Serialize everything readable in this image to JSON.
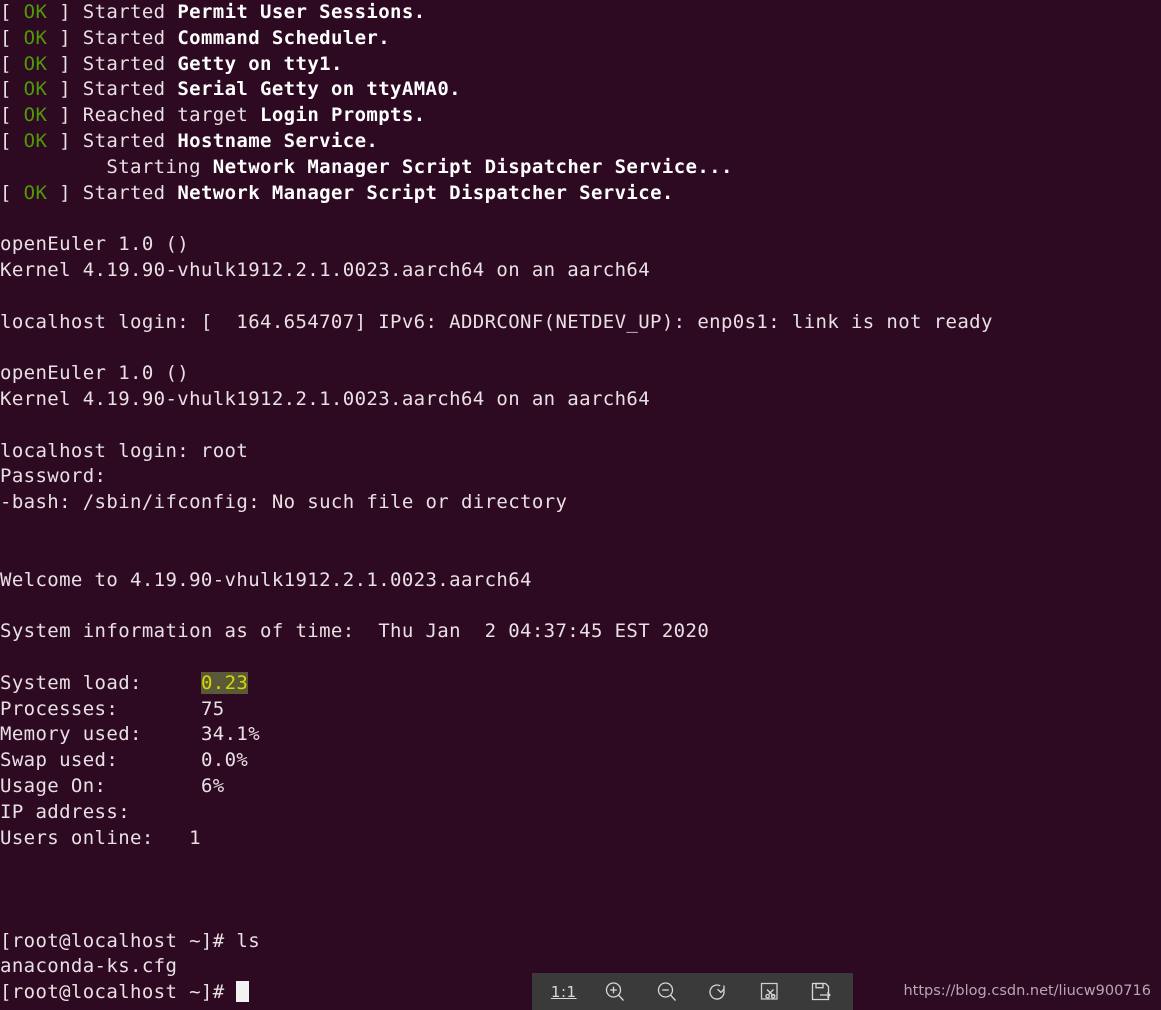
{
  "terminal": {
    "background_color": "#2d0a22",
    "text_color": "#e8e0e4",
    "ok_color": "#4e9a06",
    "highlight_bg": "#5a5a3a",
    "highlight_fg": "#d6d600",
    "boot_messages": [
      {
        "status": "OK",
        "verb": "Started",
        "unit": "Permit User Sessions."
      },
      {
        "status": "OK",
        "verb": "Started",
        "unit": "Command Scheduler."
      },
      {
        "status": "OK",
        "verb": "Started",
        "unit": "Getty on tty1."
      },
      {
        "status": "OK",
        "verb": "Started",
        "unit": "Serial Getty on ttyAMA0."
      },
      {
        "status": "OK",
        "verb": "Reached target",
        "unit": "Login Prompts."
      },
      {
        "status": "OK",
        "verb": "Started",
        "unit": "Hostname Service."
      },
      {
        "status": "",
        "verb": "Starting",
        "unit": "Network Manager Script Dispatcher Service..."
      },
      {
        "status": "OK",
        "verb": "Started",
        "unit": "Network Manager Script Dispatcher Service."
      }
    ],
    "issue_banner_1": {
      "distro": "openEuler 1.0 ()",
      "kernel": "Kernel 4.19.90-vhulk1912.2.1.0023.aarch64 on an aarch64"
    },
    "login_prompt_1": "localhost login: [  164.654707] IPv6: ADDRCONF(NETDEV_UP): enp0s1: link is not ready",
    "issue_banner_2": {
      "distro": "openEuler 1.0 ()",
      "kernel": "Kernel 4.19.90-vhulk1912.2.1.0023.aarch64 on an aarch64"
    },
    "login_prompt_2": "localhost login: root",
    "password_prompt": "Password:",
    "bash_error": "-bash: /sbin/ifconfig: No such file or directory",
    "welcome": "Welcome to 4.19.90-vhulk1912.2.1.0023.aarch64",
    "sysinfo_header": "System information as of time:  Thu Jan  2 04:37:45 EST 2020",
    "sysinfo": [
      {
        "label": "System load:",
        "value": "0.23",
        "highlighted": true
      },
      {
        "label": "Processes:",
        "value": "75",
        "highlighted": false
      },
      {
        "label": "Memory used:",
        "value": "34.1%",
        "highlighted": false
      },
      {
        "label": "Swap used:",
        "value": "0.0%",
        "highlighted": false
      },
      {
        "label": "Usage On:",
        "value": "6%",
        "highlighted": false
      },
      {
        "label": "IP address:",
        "value": "",
        "highlighted": false
      },
      {
        "label": "Users online:",
        "value": "1",
        "highlighted": false
      }
    ],
    "shell": {
      "prompt": "[root@localhost ~]# ",
      "command": "ls",
      "output": "anaconda-ks.cfg",
      "final_prompt": "[root@localhost ~]# "
    }
  },
  "toolbar": {
    "background_color": "#3a3a3a",
    "items": [
      {
        "name": "actual-size",
        "label": "1:1",
        "icon": "one-to-one-text"
      },
      {
        "name": "zoom-in",
        "label": "",
        "icon": "zoom-in-icon"
      },
      {
        "name": "zoom-out",
        "label": "",
        "icon": "zoom-out-icon"
      },
      {
        "name": "rotate",
        "label": "",
        "icon": "rotate-icon"
      },
      {
        "name": "crop",
        "label": "",
        "icon": "crop-scissors-icon"
      },
      {
        "name": "save",
        "label": "",
        "icon": "save-floppy-icon"
      }
    ]
  },
  "watermark": {
    "text": "https://blog.csdn.net/liucw900716",
    "color": "#b9a6b2"
  }
}
